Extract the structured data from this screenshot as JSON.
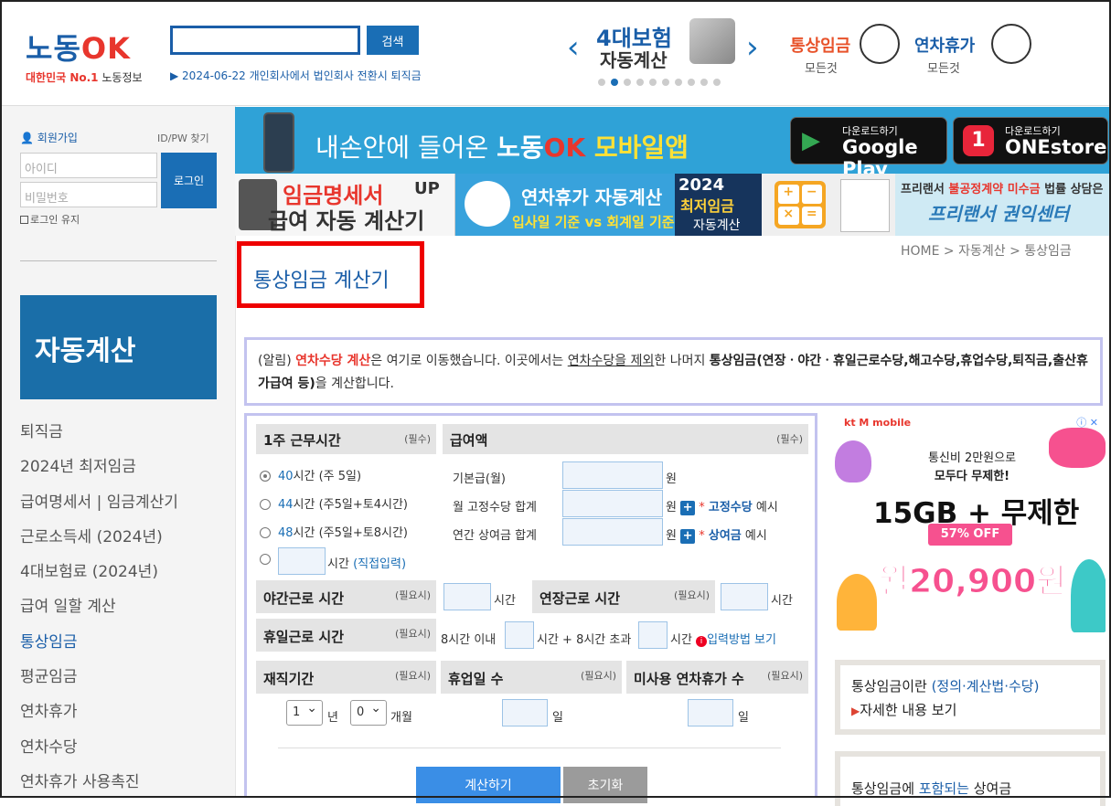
{
  "header": {
    "logo": "노동OK",
    "logo_sub_red": "대한민국 No.1",
    "logo_sub": "노동정보",
    "search_label": "검색",
    "ticker": "▶ 2024-06-22 개인회사에서 법인회사 전환시 퇴직금",
    "banner_4_line1": "4대보험",
    "banner_4_line2": "자동계산",
    "wage_title": "통상임금",
    "wage_sub": "모든것",
    "annual_title": "연차휴가",
    "annual_sub": "모든것"
  },
  "sidebar": {
    "join": "회원가입",
    "find": "ID/PW 찾기",
    "id_placeholder": "아이디",
    "pw_placeholder": "비밀번호",
    "login": "로그인",
    "keep": "로그인 유지",
    "section_title": "자동계산",
    "menu": [
      "퇴직금",
      "2024년 최저임금",
      "급여명세서 | 임금계산기",
      "근로소득세 (2024년)",
      "4대보험료 (2024년)",
      "급여 일할 계산",
      "통상임금",
      "평균임금",
      "연차휴가",
      "연차수당",
      "연차휴가 사용촉진"
    ]
  },
  "banners": {
    "app_pre": "내손안에 들어온 ",
    "app_brand_a": "노동",
    "app_brand_b": "OK",
    "app_post": " 모바일앱",
    "gp_small": "다운로드하기",
    "gp_big": "Google Play",
    "one_small": "다운로드하기",
    "one_big": "ONEstore",
    "payslip_1": "임금명세서",
    "payslip_up": "UP",
    "payslip_2": "급여 자동 계산기",
    "leave_1": "연차휴가 자동계산",
    "leave_2": "입사일 기준 vs 회계일 기준",
    "min_year": "2024",
    "min_wage": "최저임금",
    "min_calc": "자동계산",
    "calc_ops": [
      "+",
      "−",
      "×",
      "="
    ],
    "free_1a": "프리랜서 ",
    "free_1b": "불공정계약 미수금",
    "free_1c": " 법률 상담은",
    "free_2": "프리랜서 권익센터"
  },
  "breadcrumb": "HOME  >  자동계산  >  통상임금",
  "page_title": "통상임금 계산기",
  "notice": {
    "p1": "(알림) ",
    "red": "연차수당 계산",
    "p2": "은 여기로 이동했습니다. 이곳에서는 ",
    "u": "연차수당을 제외",
    "p3": "한 나머지 ",
    "bold": "통상임금(연장ㆍ야간ㆍ휴일근로수당,해고수당,휴업수당,퇴직금,출산휴가급여 등)",
    "p4": "을 계산합니다."
  },
  "form": {
    "weekly_hours": "1주 근무시간",
    "required": "(필수)",
    "optional": "(필요시)",
    "salary": "급여액",
    "opt40_num": "40",
    "opt40": "시간 (주 5일)",
    "opt44_num": "44",
    "opt44": "시간 (주5일+토4시간)",
    "opt48_num": "48",
    "opt48": "시간 (주5일+토8시간)",
    "opt_custom": "시간 ",
    "opt_custom_link": "(직접입력)",
    "base_pay": "기본급(월)",
    "fixed_allow": "월 고정수당 합계",
    "annual_bonus": "연간 상여금 합계",
    "won": "원",
    "fixed_example_a": "* ",
    "fixed_example_b": "고정수당",
    "fixed_example_c": " 예시",
    "bonus_example_a": "* ",
    "bonus_example_b": "상여금",
    "bonus_example_c": " 예시",
    "night": "야간근로 시간",
    "overtime": "연장근로 시간",
    "hours_unit": "시간",
    "holiday": "휴일근로 시간",
    "within8": "8시간 이내",
    "over8": "시간 + 8시간 초과",
    "howto": "입력방법 보기",
    "tenure": "재직기간",
    "leave_days": "휴업일 수",
    "unused_leave": "미사용 연차휴가 수",
    "years": "1",
    "year_unit": "년",
    "months": "0",
    "month_unit": "개월",
    "day_unit": "일",
    "calculate": "계산하기",
    "reset": "초기화"
  },
  "ad": {
    "brand": "kt M mobile",
    "line1": "통신비 2만원으로",
    "line2": "모두다 무제한!",
    "big": "15GB + 무제한",
    "off": "57% OFF",
    "price": "월20,900원"
  },
  "side_links": {
    "def_a": "통상임금이란 ",
    "def_b": "(정의·계산법·수당)",
    "more": "자세한 내용 보기",
    "bonus_a": "통상임금에 ",
    "bonus_b": "포함되는",
    "bonus_c": " 상여금"
  }
}
